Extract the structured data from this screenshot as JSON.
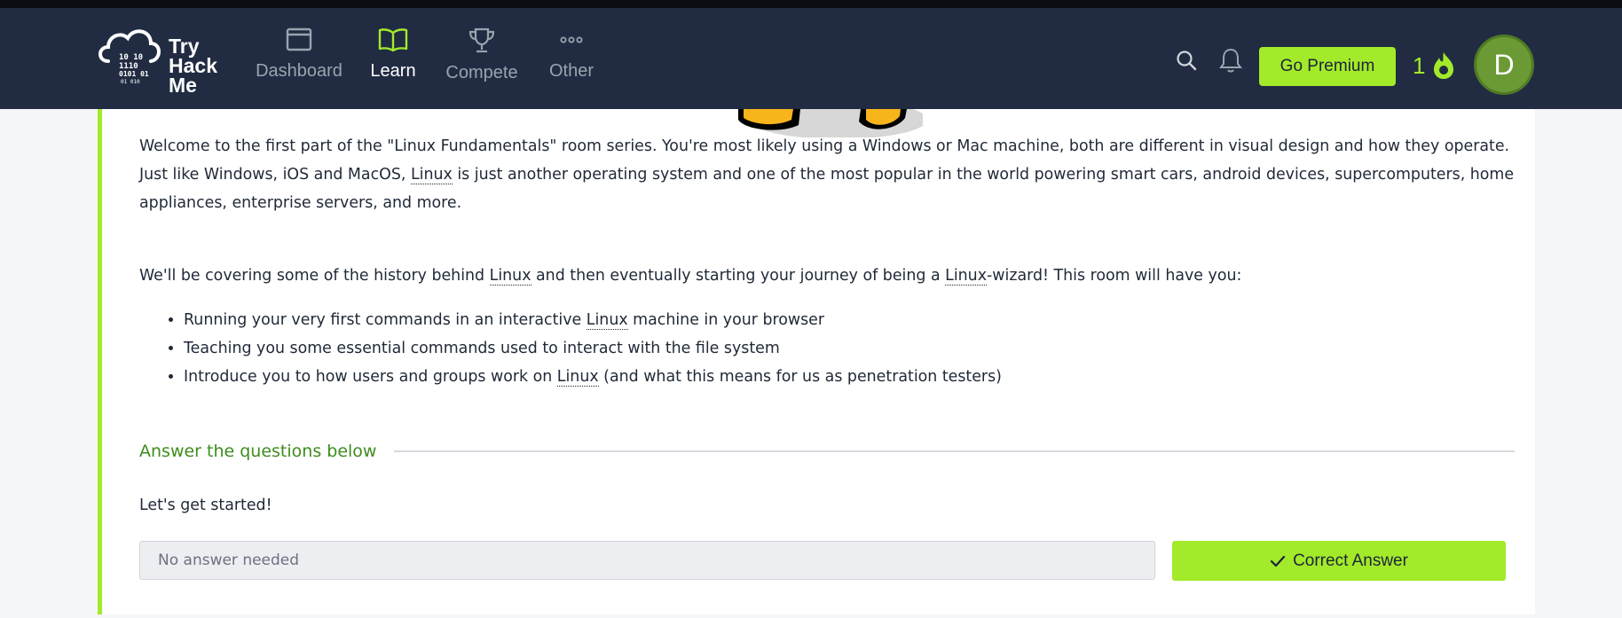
{
  "brand": {
    "line1": "Try",
    "line2": "Hack",
    "line3": "Me"
  },
  "nav": {
    "items": [
      {
        "label": "Dashboard",
        "icon": "dashboard-icon"
      },
      {
        "label": "Learn",
        "icon": "book-icon"
      },
      {
        "label": "Compete",
        "icon": "trophy-icon"
      },
      {
        "label": "Other",
        "icon": "more-icon"
      }
    ],
    "premium_label": "Go Premium",
    "streak": "1",
    "avatar_initial": "D"
  },
  "content": {
    "p1": {
      "a": "Welcome to the first part of the \"Linux Fundamentals\" room series. You're most likely using a Windows or Mac machine, both are different in visual design and how they operate. Just like Windows, iOS and MacOS, ",
      "link": "Linux",
      "b": " is just another operating system and one of the most popular in the world powering smart cars, android devices, supercomputers, home appliances, enterprise servers, and more."
    },
    "p2": {
      "a": "We'll be covering some of the history behind ",
      "link1": "Linux",
      "b": " and then eventually starting your journey of being a ",
      "link2": "Linux",
      "c": "-wizard! This room will have you:"
    },
    "bullets": [
      {
        "a": "Running your very first commands in an interactive ",
        "link": "Linux",
        "b": " machine in your browser"
      },
      {
        "a": "Teaching you some essential commands used to interact with the file system",
        "link": "",
        "b": ""
      },
      {
        "a": "Introduce you to how users and groups work on ",
        "link": "Linux",
        "b": " (and what this means for us as penetration testers)"
      }
    ]
  },
  "questions": {
    "heading": "Answer the questions below",
    "q1": "Let's get started!",
    "placeholder": "No answer needed",
    "button_label": "Correct Answer"
  },
  "colors": {
    "accent": "#a3ea2a",
    "nav_bg": "#212c42",
    "heading_green": "#3d8d1c"
  }
}
